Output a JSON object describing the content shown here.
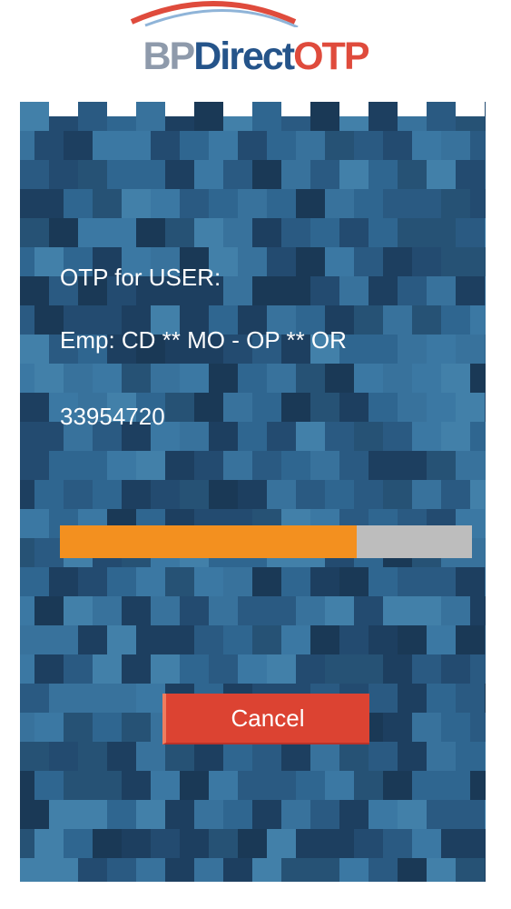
{
  "app": {
    "logo": {
      "bp": "BP",
      "direct": "Direct",
      "otp": "OTP"
    }
  },
  "otp_panel": {
    "title": "OTP for USER:",
    "user_line": "Emp: CD ** MO - OP ** OR",
    "otp_code": "33954720",
    "progress_fraction": 0.72
  },
  "actions": {
    "cancel_label": "Cancel"
  },
  "colors": {
    "panel_background": "#2f5d82",
    "progress_fill": "#f3901f",
    "progress_track": "#bdbdbd",
    "cancel_button": "#dc4332",
    "logo_grey": "#8e9aab",
    "logo_blue": "#25548a",
    "logo_red": "#df4b3c"
  }
}
